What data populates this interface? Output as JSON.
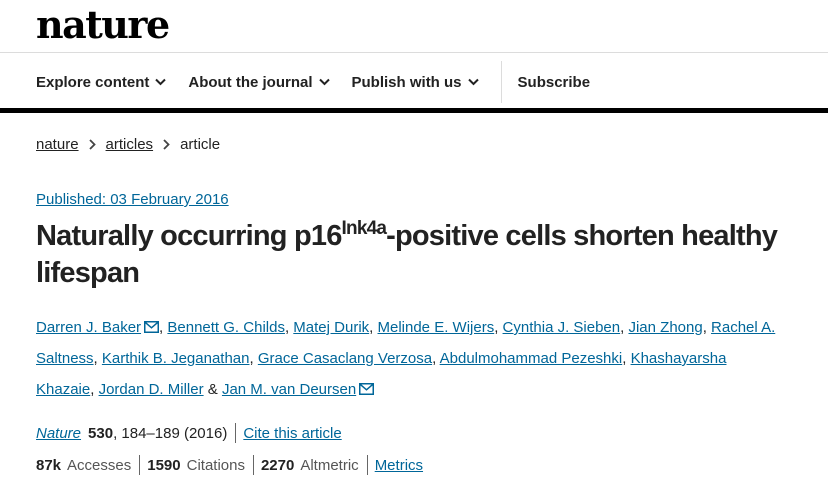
{
  "brand": {
    "logo": "nature"
  },
  "nav": {
    "explore": "Explore content",
    "about": "About the journal",
    "publish": "Publish with us",
    "subscribe": "Subscribe"
  },
  "breadcrumb": {
    "items": [
      "nature",
      "articles",
      "article"
    ]
  },
  "article": {
    "published": "Published: 03 February 2016",
    "title_part1": "Naturally occurring p16",
    "title_sup": "Ink4a",
    "title_part2": "-positive cells shorten healthy lifespan",
    "authors": [
      "Darren J. Baker",
      "Bennett G. Childs",
      "Matej Durik",
      "Melinde E. Wijers",
      "Cynthia J. Sieben",
      "Jian Zhong",
      "Rachel A. Saltness",
      "Karthik B. Jeganathan",
      "Grace Casaclang Verzosa",
      "Abdulmohammad Pezeshki",
      "Khashayarsha Khazaie",
      "Jordan D. Miller",
      "Jan M. van Deursen"
    ],
    "and_text": "&"
  },
  "citation": {
    "journal": "Nature",
    "volume": "530",
    "pages_year": ", 184–189 (2016)",
    "cite_link": "Cite this article"
  },
  "metrics": {
    "accesses_value": "87k",
    "accesses_label": "Accesses",
    "citations_value": "1590",
    "citations_label": "Citations",
    "altmetric_value": "2270",
    "altmetric_label": "Altmetric",
    "metrics_link": "Metrics"
  },
  "colors": {
    "link": "#006699",
    "text": "#222222",
    "rule": "#000000"
  }
}
